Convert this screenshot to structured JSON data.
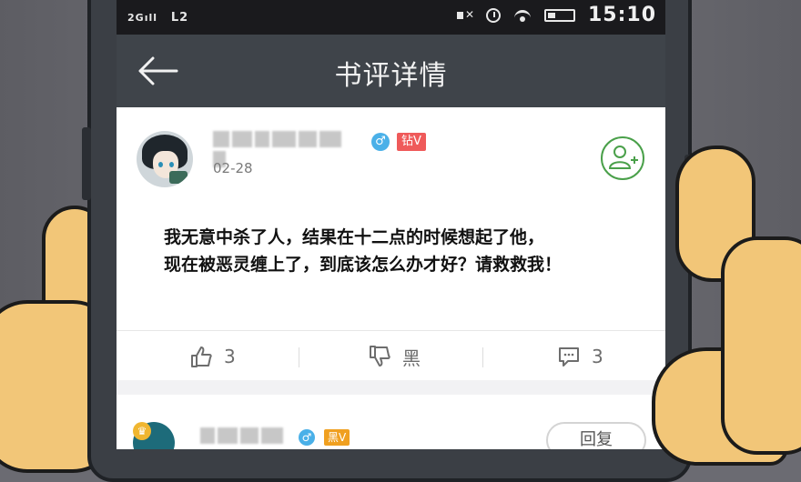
{
  "statusbar": {
    "network": "2G",
    "lte": "L2",
    "time": "15:10"
  },
  "header": {
    "title": "书评详情"
  },
  "review": {
    "date": "02-28",
    "badge": "钻V",
    "gender_symbol": "♂",
    "text_line1": "我无意中杀了人，结果在十二点的时候想起了他，",
    "text_line2": "现在被恶灵缠上了，到底该怎么办才好？请救救我！"
  },
  "actions": {
    "like_count": "3",
    "dislike_label": "黑",
    "comment_count": "3"
  },
  "reply": {
    "gender_symbol": "♂",
    "badge": "黑V",
    "button_label": "回复"
  }
}
